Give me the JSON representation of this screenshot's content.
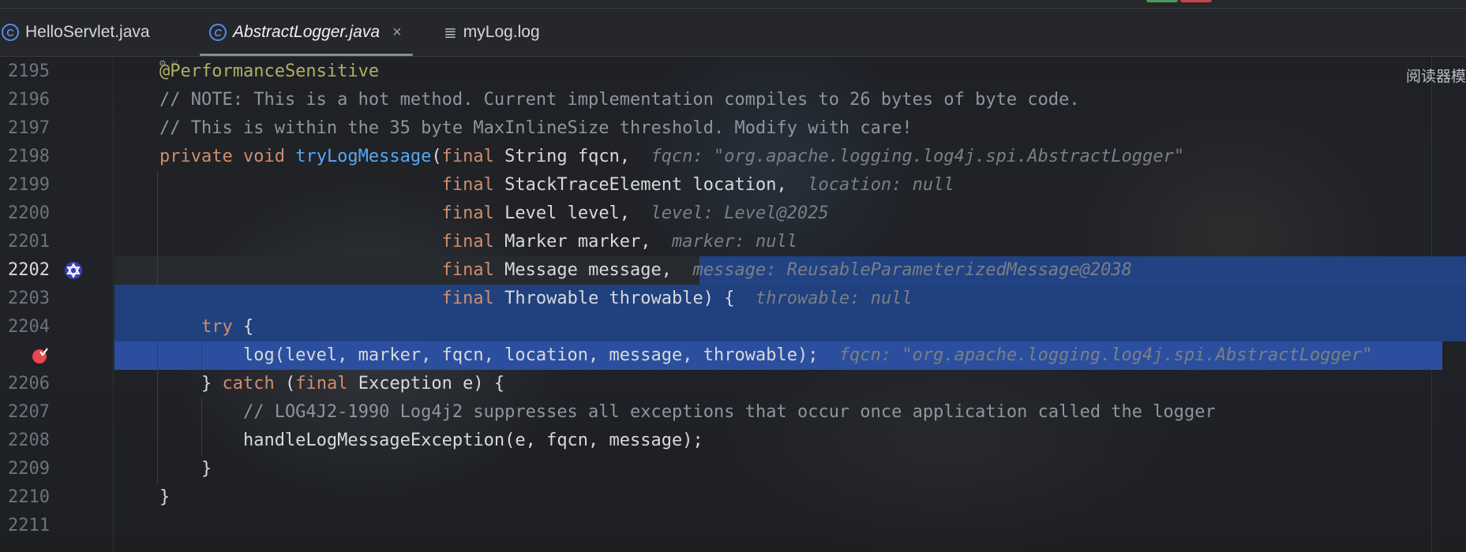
{
  "colors": {
    "keyword": "#cf8e6d",
    "annotation": "#b3ae60",
    "method": "#56a8f5",
    "comment": "#8f959d",
    "selection": "#214283",
    "breakpoint": "#e5484d",
    "tab_icon": "#5a8ae6"
  },
  "tabs": [
    {
      "label": "HelloServlet.java",
      "icon": "class-icon",
      "active": false
    },
    {
      "label": "AbstractLogger.java",
      "icon": "class-icon",
      "active": true,
      "close": "×"
    },
    {
      "label": "myLog.log",
      "icon": "log-file-icon",
      "active": false
    }
  ],
  "editor": {
    "reader_mode_label": "阅读器模",
    "lines": [
      {
        "num": "2195",
        "code": [
          {
            "t": "@PerformanceSensitive",
            "c": "ann"
          }
        ]
      },
      {
        "num": "2196",
        "code": [
          {
            "t": "// NOTE: This is a hot method. Current implementation compiles to 26 bytes of byte code.",
            "c": "cm"
          }
        ]
      },
      {
        "num": "2197",
        "code": [
          {
            "t": "// This is within the 35 byte MaxInlineSize threshold. Modify with care!",
            "c": "cm"
          }
        ]
      },
      {
        "num": "2198",
        "code": [
          {
            "t": "private ",
            "c": "kw"
          },
          {
            "t": "void ",
            "c": "kw"
          },
          {
            "t": "tryLogMessage",
            "c": "fn"
          },
          {
            "t": "(",
            "c": "tx"
          },
          {
            "t": "final ",
            "c": "kw"
          },
          {
            "t": "String fqcn,  ",
            "c": "tx"
          },
          {
            "t": "fqcn: \"org.apache.logging.log4j.spi.AbstractLogger\"",
            "c": "hint"
          }
        ]
      },
      {
        "num": "2199",
        "code": [
          {
            "t": "                           ",
            "c": "tx"
          },
          {
            "t": "final ",
            "c": "kw"
          },
          {
            "t": "StackTraceElement location,  ",
            "c": "tx"
          },
          {
            "t": "location: null",
            "c": "hint"
          }
        ]
      },
      {
        "num": "2200",
        "code": [
          {
            "t": "                           ",
            "c": "tx"
          },
          {
            "t": "final ",
            "c": "kw"
          },
          {
            "t": "Level level,  ",
            "c": "tx"
          },
          {
            "t": "level: Level@2025",
            "c": "hint"
          }
        ]
      },
      {
        "num": "2201",
        "code": [
          {
            "t": "                           ",
            "c": "tx"
          },
          {
            "t": "final ",
            "c": "kw"
          },
          {
            "t": "Marker marker,  ",
            "c": "tx"
          },
          {
            "t": "marker: null",
            "c": "hint"
          }
        ]
      },
      {
        "num": "2202",
        "code": [
          {
            "t": "                           ",
            "c": "tx"
          },
          {
            "t": "final ",
            "c": "kw"
          },
          {
            "t": "Message message,  ",
            "c": "tx"
          },
          {
            "t": "message: ReusableParameterizedMessage@2038",
            "c": "hint"
          }
        ]
      },
      {
        "num": "2203",
        "code": [
          {
            "t": "                           ",
            "c": "tx"
          },
          {
            "t": "final ",
            "c": "kw"
          },
          {
            "t": "Throwable throwable) {  ",
            "c": "tx"
          },
          {
            "t": "throwable: null",
            "c": "hint"
          }
        ]
      },
      {
        "num": "2204",
        "code": [
          {
            "t": "    ",
            "c": "tx"
          },
          {
            "t": "try ",
            "c": "kw"
          },
          {
            "t": "{",
            "c": "tx"
          }
        ]
      },
      {
        "num": "",
        "code": [
          {
            "t": "        log(level, marker, fqcn, location, message, throwable);  ",
            "c": "tx"
          },
          {
            "t": "fqcn: \"org.apache.logging.log4j.spi.AbstractLogger\"",
            "c": "hint"
          }
        ]
      },
      {
        "num": "2206",
        "code": [
          {
            "t": "    } ",
            "c": "tx"
          },
          {
            "t": "catch ",
            "c": "kw"
          },
          {
            "t": "(",
            "c": "tx"
          },
          {
            "t": "final ",
            "c": "kw"
          },
          {
            "t": "Exception e) {",
            "c": "tx"
          }
        ]
      },
      {
        "num": "2207",
        "code": [
          {
            "t": "        // LOG4J2-1990 Log4j2 suppresses all exceptions that occur once application called the logger",
            "c": "cm"
          }
        ]
      },
      {
        "num": "2208",
        "code": [
          {
            "t": "        handleLogMessageException(e, fqcn, message);",
            "c": "tx"
          }
        ]
      },
      {
        "num": "2209",
        "code": [
          {
            "t": "    }",
            "c": "tx"
          }
        ]
      },
      {
        "num": "2210",
        "code": [
          {
            "t": "}",
            "c": "tx"
          }
        ]
      },
      {
        "num": "2211",
        "code": []
      }
    ]
  }
}
